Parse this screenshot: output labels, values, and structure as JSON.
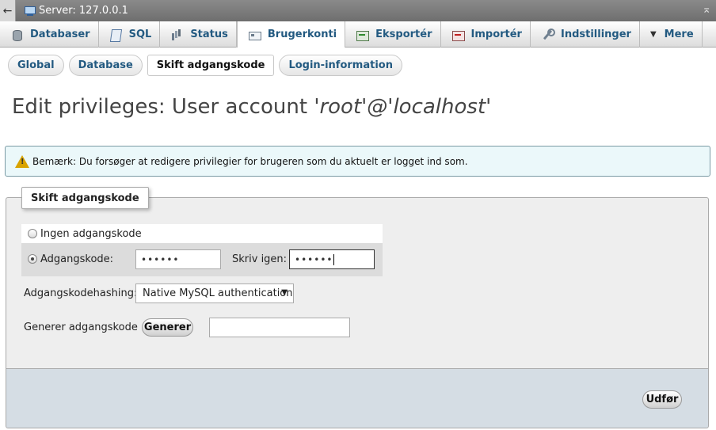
{
  "window": {
    "server_label": "Server: 127.0.0.1"
  },
  "tabs": [
    {
      "label": "Databaser",
      "icon": "database-icon"
    },
    {
      "label": "SQL",
      "icon": "sql-icon"
    },
    {
      "label": "Status",
      "icon": "status-icon"
    },
    {
      "label": "Brugerkonti",
      "icon": "users-icon",
      "active": true
    },
    {
      "label": "Eksportér",
      "icon": "export-icon"
    },
    {
      "label": "Importér",
      "icon": "import-icon"
    },
    {
      "label": "Indstillinger",
      "icon": "settings-icon"
    },
    {
      "label": "Mere",
      "icon": "chevron-down-icon"
    }
  ],
  "subtabs": [
    {
      "label": "Global"
    },
    {
      "label": "Database"
    },
    {
      "label": "Skift adgangskode",
      "active": true
    },
    {
      "label": "Login-information"
    }
  ],
  "page": {
    "title_prefix": "Edit privileges: User account ",
    "title_account": "'root'@'localhost'"
  },
  "notice": {
    "text": "Bemærk: Du forsøger at redigere privilegier for brugeren som du aktuelt er logget ind som."
  },
  "form": {
    "legend": "Skift adgangskode",
    "no_password_label": "Ingen adgangskode",
    "password_label": "Adgangskode:",
    "password_value": "••••••",
    "retype_label": "Skriv igen:",
    "retype_value": "••••••",
    "hashing_label": "Adgangskodehashing:",
    "hashing_selected": "Native MySQL authentication",
    "generate_label": "Generer adgangskode",
    "generate_button": "Generer",
    "generated_value": "",
    "submit_button": "Udfør"
  }
}
